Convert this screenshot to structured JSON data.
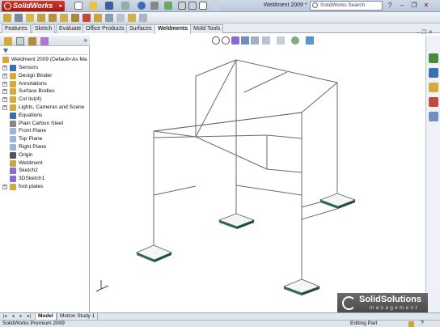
{
  "app": {
    "logo_text": "SolidWorks",
    "document_title": "Weldment 2009 *",
    "search_placeholder": "SolidWorks Search"
  },
  "command_tabs": [
    "Features",
    "Sketch",
    "Evaluate",
    "Office Products",
    "Surfaces",
    "Weldments",
    "Mold Tools"
  ],
  "active_tab": "Weldments",
  "feature_tree": {
    "root": "Weldment 2009  (Default<As Ma",
    "items": [
      {
        "label": "Sensors",
        "icon": "sensors-icon",
        "expandable": true
      },
      {
        "label": "Design Binder",
        "icon": "design-binder-icon",
        "expandable": true
      },
      {
        "label": "Annotations",
        "icon": "annotations-icon",
        "expandable": true
      },
      {
        "label": "Surface Bodies",
        "icon": "surface-bodies-icon",
        "expandable": true
      },
      {
        "label": "Cut list(4)",
        "icon": "cut-list-icon",
        "expandable": true
      },
      {
        "label": "Lights, Cameras and Scene",
        "icon": "lights-icon",
        "expandable": true
      },
      {
        "label": "Equations",
        "icon": "equations-icon",
        "expandable": false
      },
      {
        "label": "Plain Carbon Steel",
        "icon": "material-icon",
        "expandable": false
      },
      {
        "label": "Front Plane",
        "icon": "plane-icon",
        "expandable": false
      },
      {
        "label": "Top Plane",
        "icon": "plane-icon",
        "expandable": false
      },
      {
        "label": "Right Plane",
        "icon": "plane-icon",
        "expandable": false
      },
      {
        "label": "Origin",
        "icon": "origin-icon",
        "expandable": false
      },
      {
        "label": "Weldment",
        "icon": "weldment-icon",
        "expandable": false
      },
      {
        "label": "Sketch2",
        "icon": "sketch-icon",
        "expandable": false
      },
      {
        "label": "3DSketch1",
        "icon": "3dsketch-icon",
        "expandable": false
      },
      {
        "label": "foot plates",
        "icon": "folder-icon",
        "expandable": true
      }
    ]
  },
  "bottom_tabs": [
    "Model",
    "Motion Study 1"
  ],
  "status": {
    "left": "SolidWorks Premium 2009",
    "middle": "Editing Part"
  },
  "watermark": {
    "line1": "SolidSolutions",
    "line2": "management"
  },
  "colors": {
    "title_red": "#c22a1f",
    "accent_blue": "#3a6fb2",
    "frame_line": "#6a6a6a",
    "foot_plate": "#2f6b53"
  }
}
